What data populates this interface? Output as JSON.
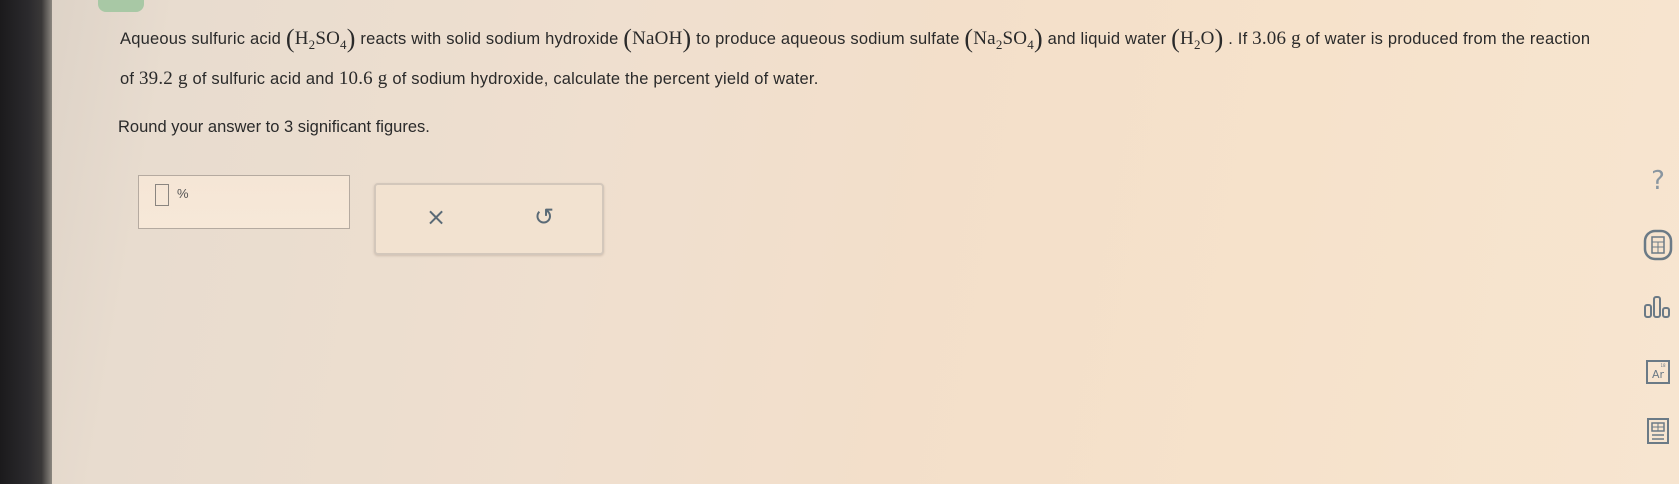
{
  "question": {
    "t1": "Aqueous sulfuric acid ",
    "t2": " reacts with solid sodium hydroxide ",
    "t3": " to produce aqueous sodium sulfate ",
    "t4": " and liquid water ",
    "t5": ". If ",
    "t6": " of water is produced from the reaction of ",
    "t7": " of sulfuric acid and ",
    "t8": " of sodium hydroxide, calculate the percent yield of water.",
    "h": "H",
    "so": "SO",
    "o": "O",
    "na": "Na",
    "naoh": "NaOH",
    "sub2": "2",
    "sub4": "4",
    "lparen": "(",
    "rparen": ")",
    "water_mass": "3.06 g",
    "acid_mass": "39.2 g",
    "base_mass": "10.6 g"
  },
  "instruction": "Round your answer to 3 significant figures.",
  "answer": {
    "value": "",
    "unit": "%"
  },
  "actions": {
    "clear_label": "×",
    "undo_label": "↺"
  },
  "tools": {
    "help_label": "?"
  },
  "icons": {
    "clear": "close-icon",
    "undo": "undo-icon",
    "calculator": "calculator-icon",
    "data": "bar-chart-icon",
    "periodic_table": "periodic-table-icon",
    "reference": "reference-icon"
  }
}
